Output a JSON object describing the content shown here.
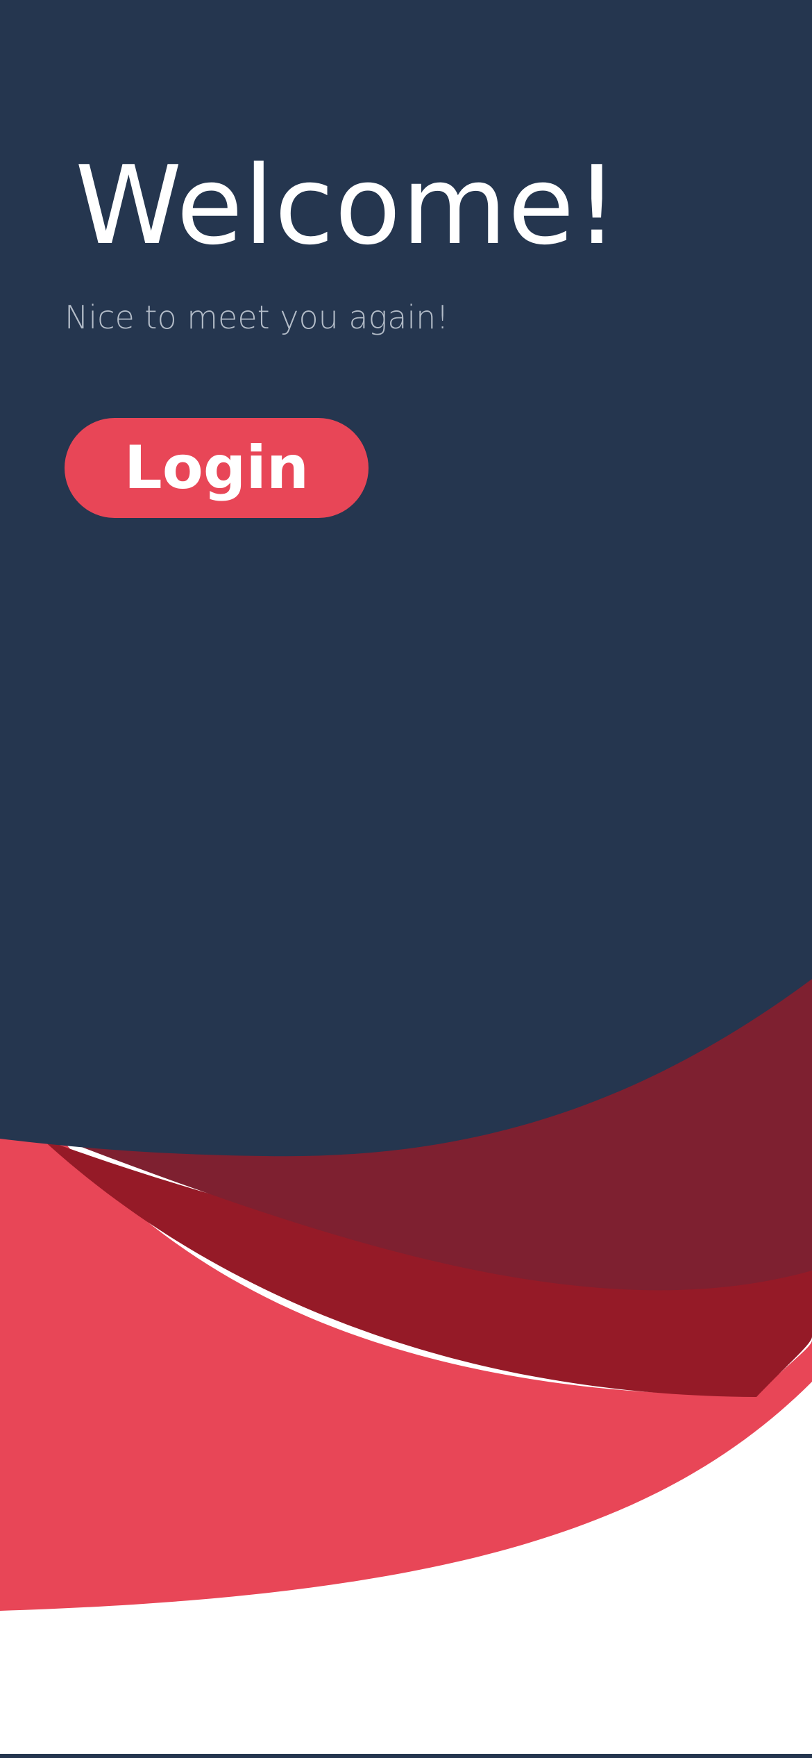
{
  "screen": {
    "title": "Welcome!",
    "subtitle": "Nice to meet you again!",
    "login_label": "Login"
  },
  "colors": {
    "navy_background": "#25364f",
    "accent_red": "#e84657",
    "dark_red": "#951a27",
    "maroon": "#7e2030",
    "subtitle_text": "#b3bcc8",
    "white": "#ffffff"
  }
}
